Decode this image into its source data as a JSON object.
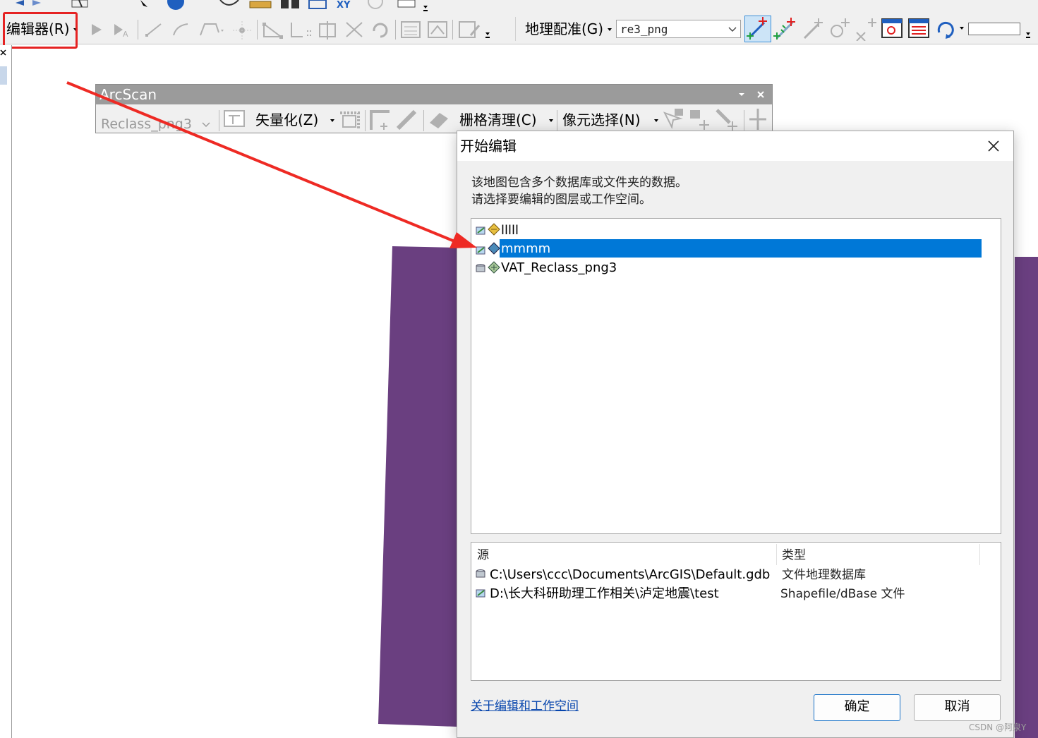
{
  "toolbar": {
    "editor_menu": "编辑器(R)",
    "georef_menu": "地理配准(G)",
    "georef_layer_select": "re3_png"
  },
  "arcscan": {
    "title": "ArcScan",
    "raster_select": "Reclass_png3",
    "vectorize_menu": "矢量化(Z)",
    "raster_cleanup_menu": "栅格清理(C)",
    "cell_selection_menu": "像元选择(N)"
  },
  "dialog": {
    "title": "开始编辑",
    "message_line1": "该地图包含多个数据库或文件夹的数据。",
    "message_line2": "请选择要编辑的图层或工作空间。",
    "layers": [
      "lllll",
      "mmmm",
      "VAT_Reclass_png3"
    ],
    "selected_layer_index": 1,
    "source_header": "源",
    "type_header": "类型",
    "sources": [
      {
        "path": "C:\\Users\\ccc\\Documents\\ArcGIS\\Default.gdb",
        "type": "文件地理数据库"
      },
      {
        "path": "D:\\长大科研助理工作相关\\泸定地震\\test",
        "type": "Shapefile/dBase 文件"
      }
    ],
    "help_link": "关于编辑和工作空间",
    "ok_button": "确定",
    "cancel_button": "取消"
  },
  "watermark": "CSDN @阿泉Y",
  "colors": {
    "selection": "#0078d7",
    "map_polygon": "#6a3f80",
    "highlight_box": "#e52222",
    "arrow": "#ee2a24",
    "link": "#0645ad",
    "dialog_bg": "#f0f0f0"
  }
}
